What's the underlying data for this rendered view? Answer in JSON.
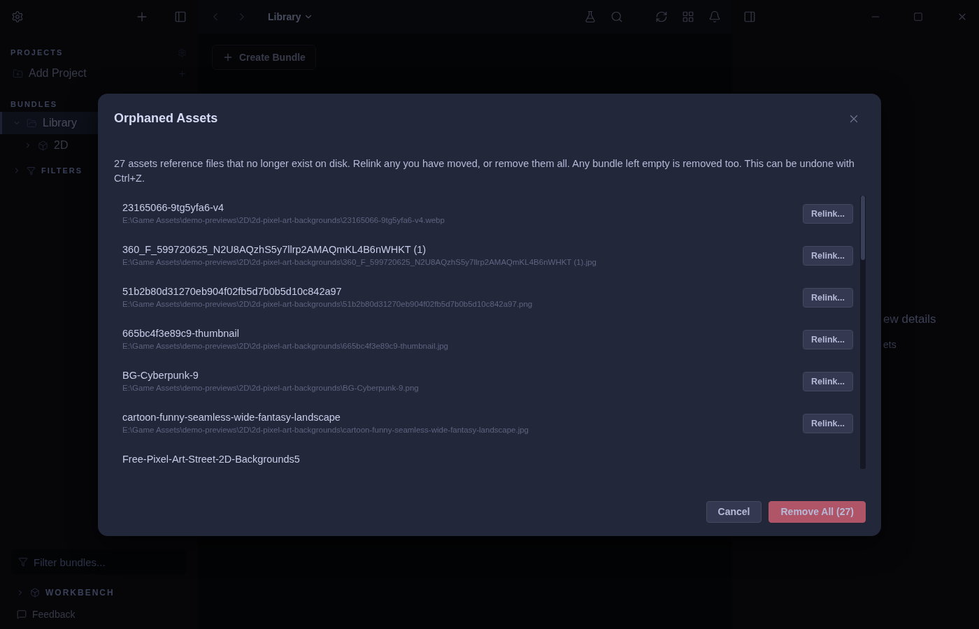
{
  "sidebar": {
    "projects": {
      "title": "PROJECTS",
      "items": [
        {
          "label": "Add Project"
        }
      ]
    },
    "bundles": {
      "title": "BUNDLES",
      "tree": [
        {
          "label": "Library",
          "selected": true,
          "expanded": true,
          "children": [
            {
              "label": "2D",
              "selected": false,
              "expanded": false
            }
          ]
        }
      ]
    },
    "filters": {
      "title": "FILTERS",
      "expanded": false
    },
    "filter_field": {
      "placeholder": "Filter bundles..."
    },
    "workbench": {
      "title": "WORKBENCH",
      "expanded": false
    },
    "feedback": "Feedback"
  },
  "toolbar": {
    "breadcrumb": "Library"
  },
  "main": {
    "create_button": "Create Bundle"
  },
  "details_panel": {
    "lines": [
      "ew details",
      "ets"
    ]
  },
  "dialog": {
    "title": "Orphaned Assets",
    "message": "27 assets reference files that no longer exist on disk. Relink any you have moved, or remove them all. Any bundle left empty is removed too. This can be undone with Ctrl+Z.",
    "assets": [
      {
        "name": "23165066-9tg5yfa6-v4",
        "path": "E:\\Game Assets\\demo-previews\\2D\\2d-pixel-art-backgrounds\\23165066-9tg5yfa6-v4.webp",
        "action": "Relink..."
      },
      {
        "name": "360_F_599720625_N2U8AQzhS5y7llrp2AMAQmKL4B6nWHKT (1)",
        "path": "E:\\Game Assets\\demo-previews\\2D\\2d-pixel-art-backgrounds\\360_F_599720625_N2U8AQzhS5y7llrp2AMAQmKL4B6nWHKT (1).jpg",
        "action": "Relink..."
      },
      {
        "name": "51b2b80d31270eb904f02fb5d7b0b5d10c842a97",
        "path": "E:\\Game Assets\\demo-previews\\2D\\2d-pixel-art-backgrounds\\51b2b80d31270eb904f02fb5d7b0b5d10c842a97.png",
        "action": "Relink..."
      },
      {
        "name": "665bc4f3e89c9-thumbnail",
        "path": "E:\\Game Assets\\demo-previews\\2D\\2d-pixel-art-backgrounds\\665bc4f3e89c9-thumbnail.jpg",
        "action": "Relink..."
      },
      {
        "name": "BG-Cyberpunk-9",
        "path": "E:\\Game Assets\\demo-previews\\2D\\2d-pixel-art-backgrounds\\BG-Cyberpunk-9.png",
        "action": "Relink..."
      },
      {
        "name": "cartoon-funny-seamless-wide-fantasy-landscape",
        "path": "E:\\Game Assets\\demo-previews\\2D\\2d-pixel-art-backgrounds\\cartoon-funny-seamless-wide-fantasy-landscape.jpg",
        "action": "Relink..."
      },
      {
        "name": "Free-Pixel-Art-Street-2D-Backgrounds5"
      }
    ],
    "buttons": [
      {
        "label": "Cancel",
        "kind": "secondary"
      },
      {
        "label": "Remove All (27)",
        "kind": "danger"
      }
    ]
  }
}
